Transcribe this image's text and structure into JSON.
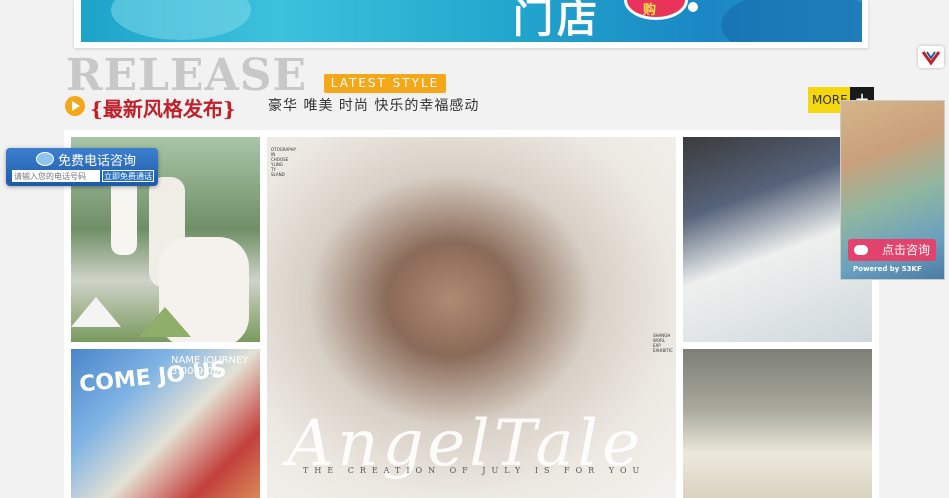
{
  "banner": {
    "text": "门店",
    "badge": "购"
  },
  "heading": {
    "release_word": "RELEASE",
    "latest_badge": "LATEST STYLE",
    "cn_title": "{最新风格发布}",
    "subtitle": "豪华 唯美 时尚 快乐的幸福感动",
    "more_label": "MORE",
    "more_plus": "+"
  },
  "gallery": {
    "center_photo": {
      "top_left_text": "OTOGRAPHY\nIN\nCHOOSE\nYLING\nTY\nSLAND",
      "right_text": "SHANGH\nWORL\nEXP\nEXHIBITIC",
      "tagline": "THE CREATION OF JULY IS FOR YOU",
      "script": "AngelTale"
    },
    "street_photo": {
      "graffiti": "COME JO   US",
      "graffiti_small": "NAME JOURNEY 3:00-9:00"
    }
  },
  "phone_widget": {
    "title": "免费电话咨询",
    "input_placeholder": "请输入您的电话号码",
    "button": "立即免费通话"
  },
  "consult_widget": {
    "button": "点击咨询",
    "powered": "Powered by 53KF"
  },
  "colors": {
    "accent_orange": "#f5a71a",
    "title_red": "#c0202a",
    "more_yellow": "#f5d70f",
    "consult_pink": "#e2436c",
    "phone_blue": "#1d5aa8"
  }
}
